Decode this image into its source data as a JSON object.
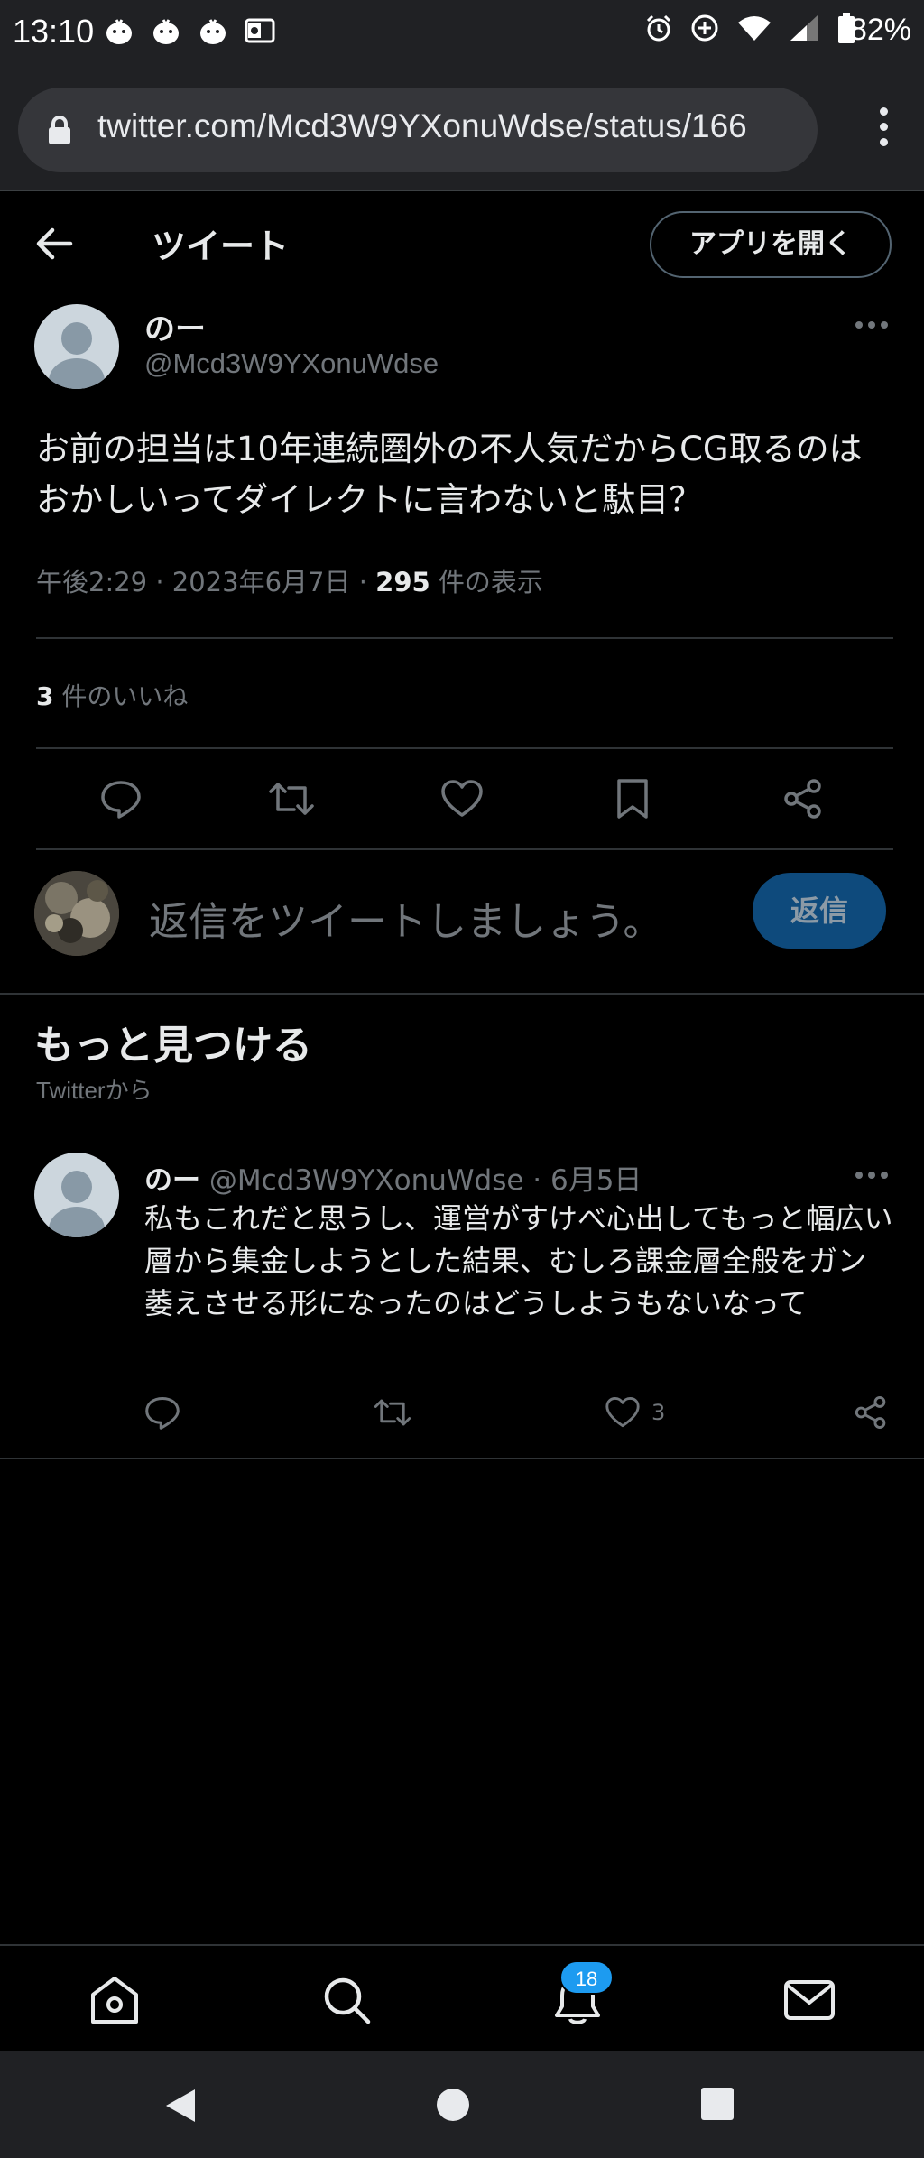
{
  "status_bar": {
    "time": "13:10",
    "battery": "82%",
    "notification_icons": [
      "chick-icon",
      "chick-icon",
      "chick-icon",
      "outlook-icon"
    ],
    "system_icons": [
      "alarm-icon",
      "data-saver-icon",
      "wifi-icon",
      "signal-icon",
      "battery-icon"
    ]
  },
  "browser": {
    "url": "twitter.com/Mcd3W9YXonuWdse/status/166"
  },
  "header": {
    "title": "ツイート",
    "open_app": "アプリを開く"
  },
  "tweet": {
    "author_name": "のー",
    "author_handle": "@Mcd3W9YXonuWdse",
    "text": "お前の担当は10年連続圏外の不人気だからCG取るのはおかしいってダイレクトに言わないと駄目？",
    "time": "午後2:29 · 2023年6月7日 · ",
    "views_count": "295",
    "views_label": " 件の表示",
    "likes_count": "3",
    "likes_label": " 件のいいね"
  },
  "reply": {
    "placeholder": "返信をツイートしましょう。",
    "button": "返信"
  },
  "discover": {
    "title": "もっと見つける",
    "subtitle": "Twitterから"
  },
  "recommended": {
    "author_name": "のー",
    "author_handle": "@Mcd3W9YXonuWdse",
    "date": " · 6月5日",
    "text": "私もこれだと思うし、運営がすけべ心出してもっと幅広い層から集金しようとした結果、むしろ課金層全般をガン萎えさせる形になったのはどうしようもないなって",
    "like_count": "3"
  },
  "bottom_nav": {
    "notification_badge": "18",
    "items": [
      "home-icon",
      "search-icon",
      "bell-icon",
      "mail-icon"
    ]
  },
  "colors": {
    "background": "#000000",
    "text_primary": "#e7e9ea",
    "text_secondary": "#71767b",
    "accent": "#1d9bf0",
    "divider": "#2f3336"
  }
}
